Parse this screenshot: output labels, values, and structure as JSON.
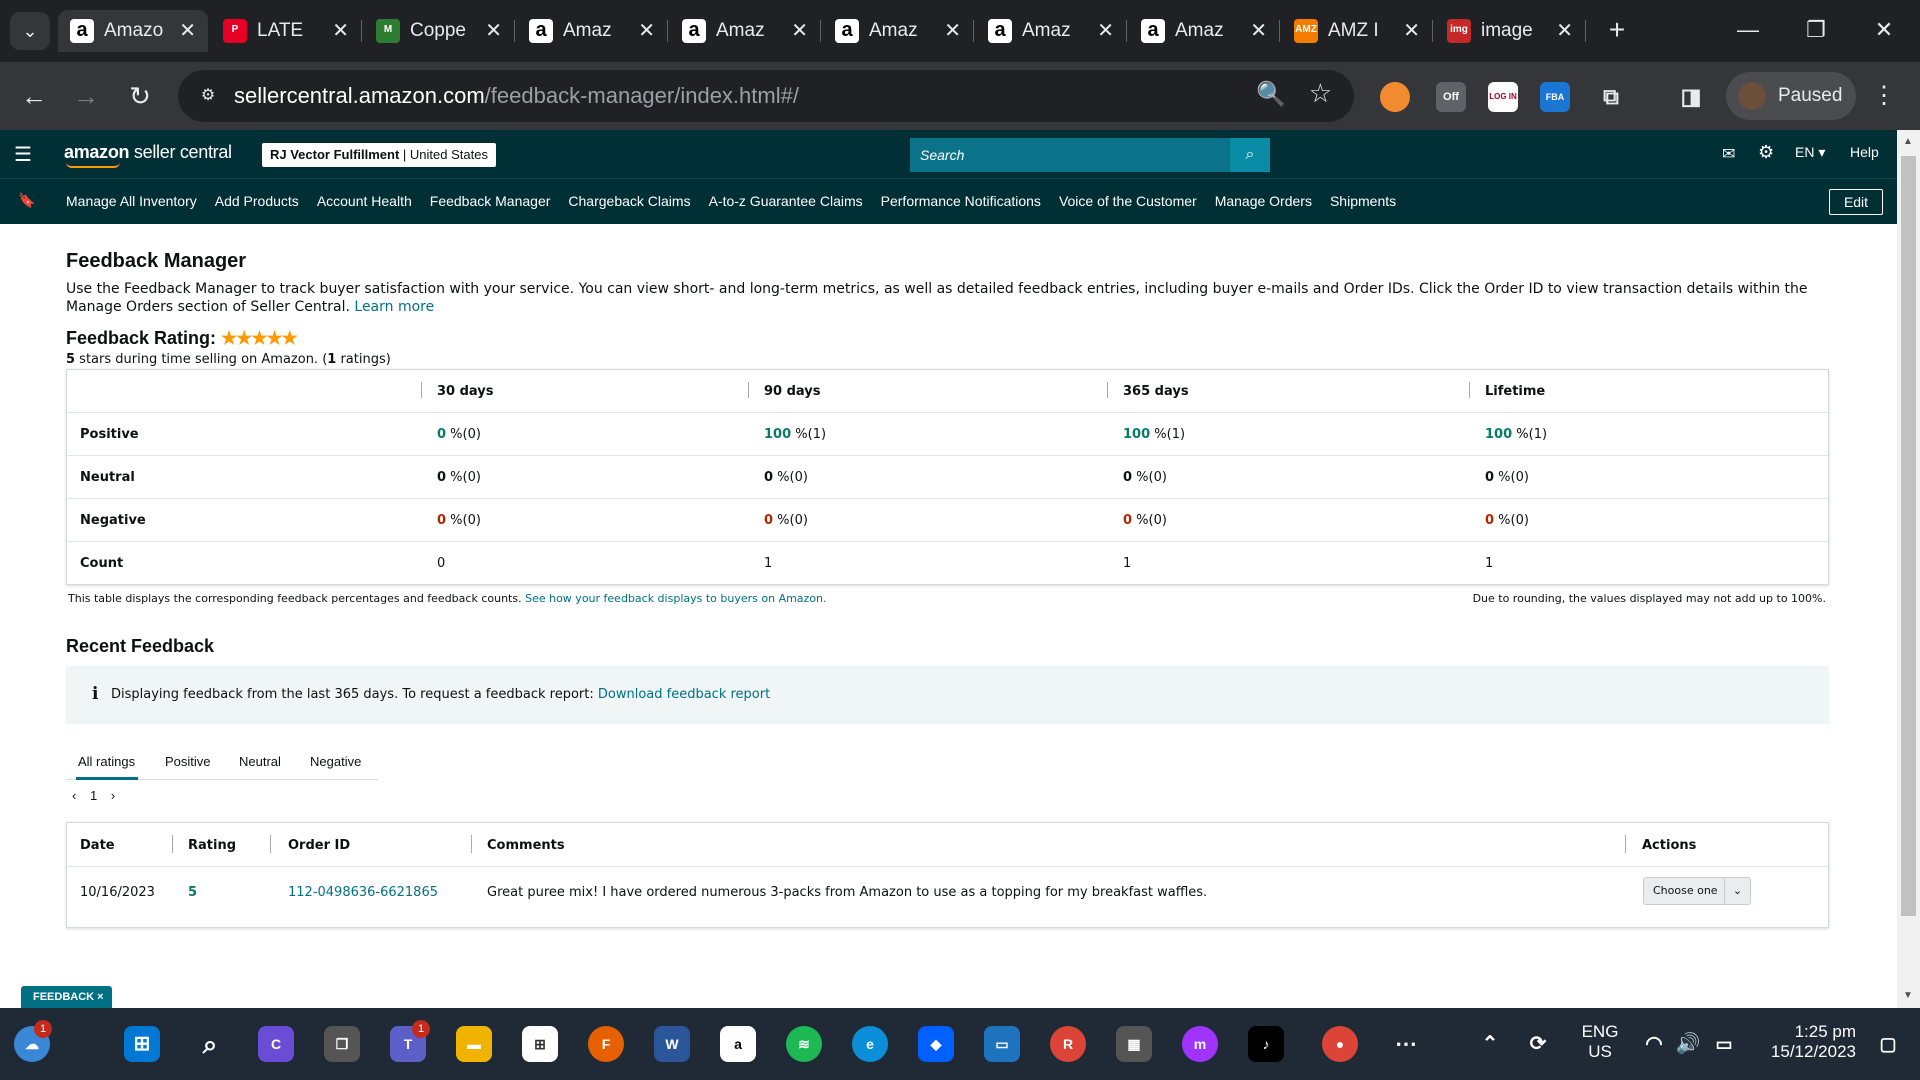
{
  "browser": {
    "tabs": [
      {
        "favicon": "a",
        "label": "Amazo",
        "active": true
      },
      {
        "favicon": "P",
        "label": "LATE"
      },
      {
        "favicon": "M",
        "label": "Coppe"
      },
      {
        "favicon": "a",
        "label": "Amaz"
      },
      {
        "favicon": "a",
        "label": "Amaz"
      },
      {
        "favicon": "a",
        "label": "Amaz"
      },
      {
        "favicon": "a",
        "label": "Amaz"
      },
      {
        "favicon": "a",
        "label": "Amaz"
      },
      {
        "favicon": "AMZ",
        "label": "AMZ I"
      },
      {
        "favicon": "img",
        "label": "image"
      }
    ],
    "url_host": "sellercentral.amazon.com",
    "url_path": "/feedback-manager/index.html#/",
    "extensions": [
      {
        "label": "●",
        "color": "#f28b30"
      },
      {
        "label": "Off",
        "color": "#5f6368"
      },
      {
        "label": "LOG IN",
        "color": "#b00020"
      },
      {
        "label": "FBA",
        "color": "#1976d2"
      }
    ],
    "profile_label": "Paused"
  },
  "header": {
    "logo_bold": "amazon",
    "logo_rest": " seller central",
    "account_name": "RJ Vector Fulfillment",
    "account_region": " | United States",
    "search_placeholder": "Search",
    "language": "EN",
    "help": "Help"
  },
  "nav": {
    "items": [
      "Manage All Inventory",
      "Add Products",
      "Account Health",
      "Feedback Manager",
      "Chargeback Claims",
      "A-to-z Guarantee Claims",
      "Performance Notifications",
      "Voice of the Customer",
      "Manage Orders",
      "Shipments"
    ],
    "edit": "Edit"
  },
  "page": {
    "title": "Feedback Manager",
    "description": "Use the Feedback Manager to track buyer satisfaction with your service. You can view short- and long-term metrics, as well as detailed feedback entries, including buyer e-mails and Order IDs. Click the Order ID to view transaction details within the Manage Orders section of Seller Central.",
    "learn_more": "Learn more",
    "rating_title": "Feedback Rating:",
    "rating_stars": 5,
    "rating_sub_1": "5",
    "rating_sub_2": " stars during time selling on Amazon. (",
    "rating_sub_3": "1",
    "rating_sub_4": " ratings)"
  },
  "metrics": {
    "columns": [
      "30 days",
      "90 days",
      "365 days",
      "Lifetime"
    ],
    "rows": [
      {
        "label": "Positive",
        "cells": [
          [
            "0",
            " %(0)"
          ],
          [
            "100",
            " %(1)"
          ],
          [
            "100",
            " %(1)"
          ],
          [
            "100",
            " %(1)"
          ]
        ]
      },
      {
        "label": "Neutral",
        "cells": [
          [
            "0",
            " %(0)"
          ],
          [
            "0",
            " %(0)"
          ],
          [
            "0",
            " %(0)"
          ],
          [
            "0",
            " %(0)"
          ]
        ]
      },
      {
        "label": "Negative",
        "cells": [
          [
            "0",
            " %(0)"
          ],
          [
            "0",
            " %(0)"
          ],
          [
            "0",
            " %(0)"
          ],
          [
            "0",
            " %(0)"
          ]
        ]
      },
      {
        "label": "Count",
        "cells": [
          [
            "0",
            ""
          ],
          [
            "1",
            ""
          ],
          [
            "1",
            ""
          ],
          [
            "1",
            ""
          ]
        ]
      }
    ],
    "note_left": "This table displays the corresponding feedback percentages and feedback counts. ",
    "note_link": "See how your feedback displays to buyers on Amazon.",
    "note_right": "Due to rounding, the values displayed may not add up to 100%."
  },
  "recent": {
    "title": "Recent Feedback",
    "info_icon": "i",
    "info_text": "Displaying feedback from the last 365 days. To request a feedback report: ",
    "info_link": "Download feedback report",
    "tabs": [
      "All ratings",
      "Positive",
      "Neutral",
      "Negative"
    ],
    "page": "1",
    "columns": [
      "Date",
      "Rating",
      "Order ID",
      "Comments",
      "Actions"
    ],
    "rows": [
      {
        "date": "10/16/2023",
        "rating": "5",
        "order_id": "112-0498636-6621865",
        "comment": "Great puree mix! I have ordered numerous 3-packs from Amazon to use as a topping for my breakfast waffles.",
        "action": "Choose one"
      }
    ]
  },
  "feedback_tab": "FEEDBACK ×",
  "taskbar": {
    "lang_1": "ENG",
    "lang_2": "US",
    "time": "1:25 pm",
    "date": "15/12/2023"
  }
}
